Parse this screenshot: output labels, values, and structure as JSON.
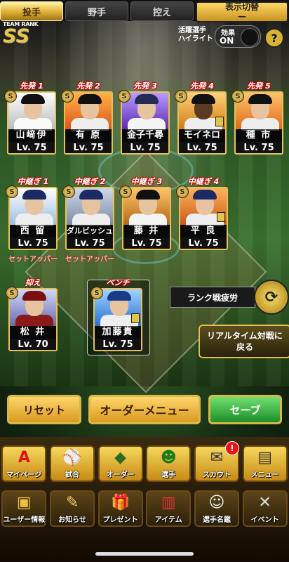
{
  "tabs": {
    "pitcher": "投手",
    "fielder": "野手",
    "bench": "控え",
    "display_switch": "表示切替",
    "display_value": "—"
  },
  "team_rank": {
    "label": "TEAM RANK",
    "value": "SS"
  },
  "highlight": {
    "line1": "活躍選手",
    "line2": "ハイライト",
    "effect_label": "効果",
    "effect_value": "ON",
    "help": "?"
  },
  "s_badge": "S",
  "starters": [
    {
      "pos": "先発 1",
      "name": "山﨑伊",
      "level": "Lv. 75"
    },
    {
      "pos": "先発 2",
      "name": "有 原",
      "level": "Lv. 75"
    },
    {
      "pos": "先発 3",
      "name": "金子千尋",
      "level": "Lv. 75"
    },
    {
      "pos": "先発 4",
      "name": "モイネロ",
      "level": "Lv. 75"
    },
    {
      "pos": "先発 5",
      "name": "種 市",
      "level": "Lv. 75"
    }
  ],
  "relievers": [
    {
      "pos": "中継ぎ 1",
      "name": "西 留",
      "level": "Lv. 75",
      "note": "セットアッパー"
    },
    {
      "pos": "中継ぎ 2",
      "name": "ダルビッシュ",
      "level": "Lv. 75",
      "note": "セットアッパー"
    },
    {
      "pos": "中継ぎ 3",
      "name": "藤 井",
      "level": "Lv. 75",
      "note": ""
    },
    {
      "pos": "中継ぎ 4",
      "name": "平 良",
      "level": "Lv. 75",
      "note": ""
    }
  ],
  "closer": {
    "pos": "抑え",
    "name": "松 井",
    "level": "Lv. 70"
  },
  "bench": {
    "pos": "ベンチ",
    "name": "加藤貴",
    "level": "Lv. 75"
  },
  "rank_fatigue": "ランク戦疲労",
  "realtime": {
    "line1": "リアルタイム対戦に",
    "line2": "戻る"
  },
  "actions": {
    "reset": "リセット",
    "order_menu": "オーダーメニュー",
    "save": "セーブ"
  },
  "menu_row1": [
    {
      "label": "マイページ",
      "icon": "A"
    },
    {
      "label": "試合",
      "icon": "⚾"
    },
    {
      "label": "オーダー",
      "icon": "◆"
    },
    {
      "label": "選手",
      "icon": "☻"
    },
    {
      "label": "スカウト",
      "icon": "✉",
      "badge": "!"
    },
    {
      "label": "メニュー",
      "icon": "▤"
    }
  ],
  "menu_row2": [
    {
      "label": "ユーザー情報",
      "icon": "▣"
    },
    {
      "label": "お知らせ",
      "icon": "✎"
    },
    {
      "label": "プレゼント",
      "icon": "🎁"
    },
    {
      "label": "アイテム",
      "icon": "▥"
    },
    {
      "label": "選手名鑑",
      "icon": "☺"
    },
    {
      "label": "イベント",
      "icon": "✕"
    }
  ]
}
